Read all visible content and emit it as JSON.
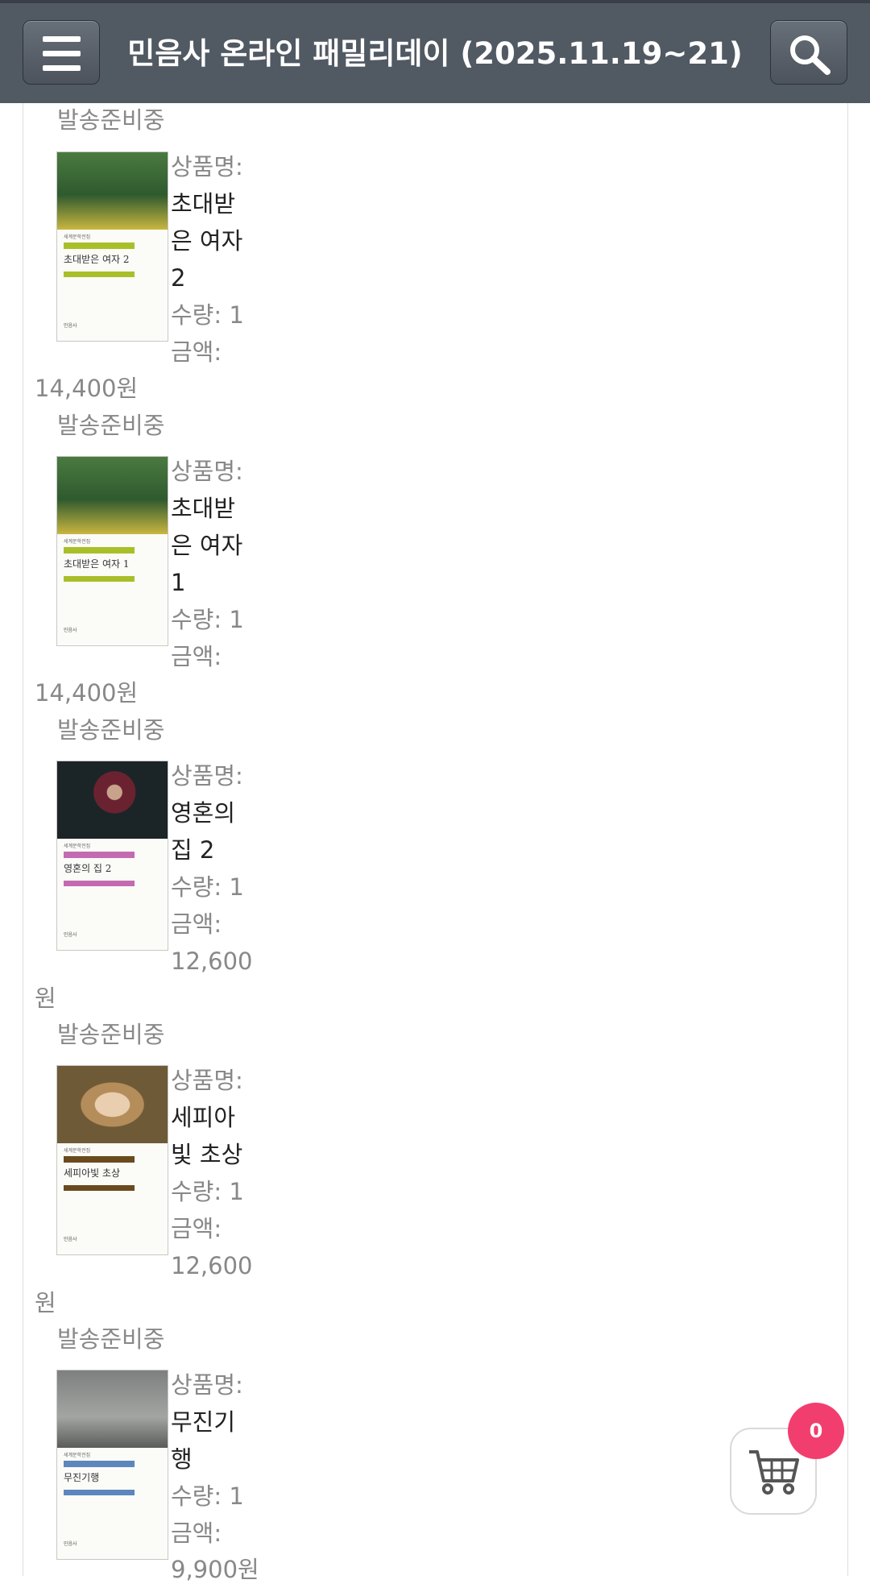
{
  "header": {
    "title": "민음사 온라인 패밀리데이 (2025.11.19~21)",
    "menu_icon": "hamburger-menu-icon",
    "search_icon": "search-icon",
    "bar_color": "#515963"
  },
  "top_status": "발송준비중",
  "labels": {
    "name": "상품명:",
    "qty_prefix": "수량: ",
    "price": "금액:"
  },
  "orders": [
    {
      "name_lines": [
        "초대받",
        "은 여자",
        "2"
      ],
      "qty": "1",
      "price_lines": [
        "14,400원"
      ],
      "status": "발송준비중",
      "cover": {
        "title": "초대받은 여자 2",
        "accent": "#a9bf2a",
        "art": "#3c6f3a"
      }
    },
    {
      "name_lines": [
        "초대받",
        "은 여자",
        "1"
      ],
      "qty": "1",
      "price_lines": [
        "14,400원"
      ],
      "status": "발송준비중",
      "cover": {
        "title": "초대받은 여자 1",
        "accent": "#a9bf2a",
        "art": "#3c6f3a"
      }
    },
    {
      "name_lines": [
        "영혼의",
        "집 2"
      ],
      "qty": "1",
      "price_lines": [
        "12,600",
        "원"
      ],
      "status": "발송준비중",
      "cover": {
        "title": "영혼의 집 2",
        "accent": "#c36bb1",
        "art": "#1f2a2c"
      }
    },
    {
      "name_lines": [
        "세피아",
        "빛 초상"
      ],
      "qty": "1",
      "price_lines": [
        "12,600",
        "원"
      ],
      "status": "발송준비중",
      "cover": {
        "title": "세피아빛 초상",
        "accent": "#6b4a1e",
        "art": "#a8895c"
      }
    },
    {
      "name_lines": [
        "무진기",
        "행"
      ],
      "qty": "1",
      "price_lines": [
        "9,900원"
      ],
      "status": "",
      "cover": {
        "title": "무진기행",
        "accent": "#5c86bd",
        "art": "#8a8c8a"
      }
    }
  ],
  "cart": {
    "count": "0",
    "icon": "shopping-cart-icon",
    "badge_color": "#f23e6f"
  }
}
